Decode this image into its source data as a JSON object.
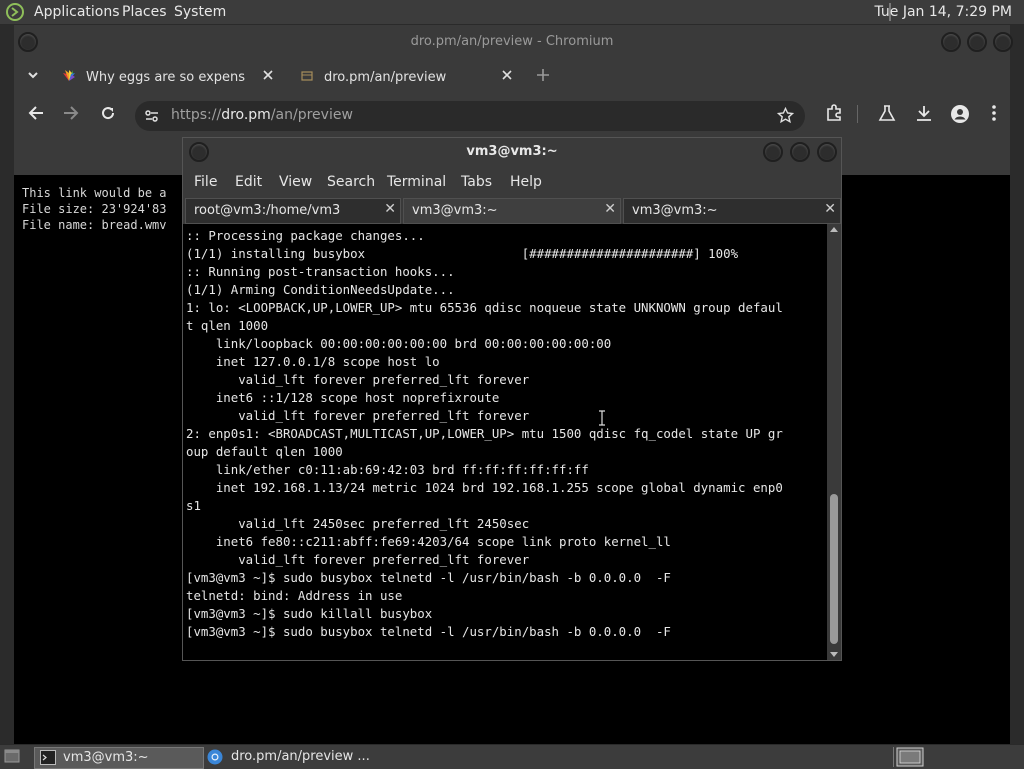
{
  "top_panel": {
    "menus": [
      "Applications",
      "Places",
      "System"
    ],
    "clock": "Tue Jan 14,  7:29 PM"
  },
  "chromium": {
    "window_title": "dro.pm/an/preview - Chromium",
    "tabs": [
      {
        "label": "Why eggs are so expensive ri",
        "favicon": "nbc-peacock-icon",
        "active": false
      },
      {
        "label": "dro.pm/an/preview",
        "favicon": "page-icon",
        "active": true
      }
    ],
    "url": {
      "scheme": "https://",
      "host": "dro.pm",
      "path": "/an/preview"
    },
    "page_lines": [
      "This link would be a",
      "File size: 23'924'83",
      "File name: bread.wmv"
    ]
  },
  "terminal": {
    "title": "vm3@vm3:~",
    "menus": [
      "File",
      "Edit",
      "View",
      "Search",
      "Terminal",
      "Tabs",
      "Help"
    ],
    "tabs": [
      {
        "label": "root@vm3:/home/vm3",
        "active": false
      },
      {
        "label": "vm3@vm3:~",
        "active": true
      },
      {
        "label": "vm3@vm3:~",
        "active": false
      }
    ],
    "lines": [
      ":: Processing package changes...",
      "(1/1) installing busybox                     [######################] 100%",
      ":: Running post-transaction hooks...",
      "(1/1) Arming ConditionNeedsUpdate...",
      "1: lo: <LOOPBACK,UP,LOWER_UP> mtu 65536 qdisc noqueue state UNKNOWN group defaul",
      "t qlen 1000",
      "    link/loopback 00:00:00:00:00:00 brd 00:00:00:00:00:00",
      "    inet 127.0.0.1/8 scope host lo",
      "       valid_lft forever preferred_lft forever",
      "    inet6 ::1/128 scope host noprefixroute",
      "       valid_lft forever preferred_lft forever",
      "2: enp0s1: <BROADCAST,MULTICAST,UP,LOWER_UP> mtu 1500 qdisc fq_codel state UP gr",
      "oup default qlen 1000",
      "    link/ether c0:11:ab:69:42:03 brd ff:ff:ff:ff:ff:ff",
      "    inet 192.168.1.13/24 metric 1024 brd 192.168.1.255 scope global dynamic enp0",
      "s1",
      "       valid_lft 2450sec preferred_lft 2450sec",
      "    inet6 fe80::c211:abff:fe69:4203/64 scope link proto kernel_ll",
      "       valid_lft forever preferred_lft forever",
      "[vm3@vm3 ~]$ sudo busybox telnetd -l /usr/bin/bash -b 0.0.0.0  -F",
      "telnetd: bind: Address in use",
      "[vm3@vm3 ~]$ sudo killall busybox",
      "[vm3@vm3 ~]$ sudo busybox telnetd -l /usr/bin/bash -b 0.0.0.0  -F"
    ]
  },
  "taskbar": {
    "items": [
      {
        "label": "vm3@vm3:~",
        "icon": "terminal-icon",
        "active": true
      },
      {
        "label": "dro.pm/an/preview ...",
        "icon": "chromium-icon",
        "active": false
      }
    ]
  },
  "colors": {
    "panel": "#3c3c3c",
    "window_chrome": "#3a3a3a",
    "terminal_bg": "#000000",
    "text": "#e6e6e6"
  }
}
